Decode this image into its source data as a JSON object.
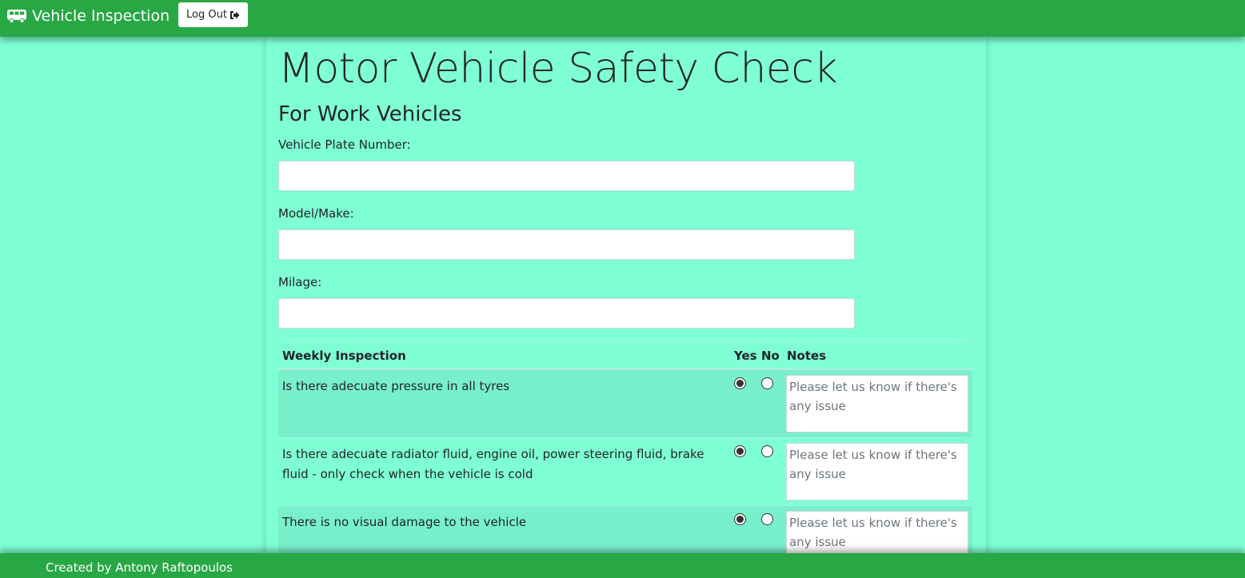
{
  "navbar": {
    "brand_icon": "bus-icon",
    "brand_text": "Vehicle Inspection",
    "logout_label": "Log Out",
    "logout_icon": "sign-out-icon",
    "color": "#28a745"
  },
  "page": {
    "title": "Motor Vehicle Safety Check",
    "subtitle": "For Work Vehicles",
    "background": "#7fffd4"
  },
  "form": {
    "plate_label": "Vehicle Plate Number:",
    "plate_value": "",
    "model_label": "Model/Make:",
    "model_value": "",
    "milage_label": "Milage:",
    "milage_value": ""
  },
  "table": {
    "headers": {
      "item": "Weekly Inspection",
      "yes": "Yes",
      "no": "No",
      "notes": "Notes"
    },
    "notes_placeholder": "Please let us know if there's any issue",
    "rows": [
      {
        "question": "Is there adecuate pressure in all tyres",
        "selected": "yes"
      },
      {
        "question": "Is there adecuate radiator fluid, engine oil, power steering fluid, brake fluid - only check when the vehicle is cold",
        "selected": "yes"
      },
      {
        "question": "There is no visual damage to the vehicle",
        "selected": "yes"
      }
    ]
  },
  "footer": {
    "text": "Created by Antony Raftopoulos"
  }
}
